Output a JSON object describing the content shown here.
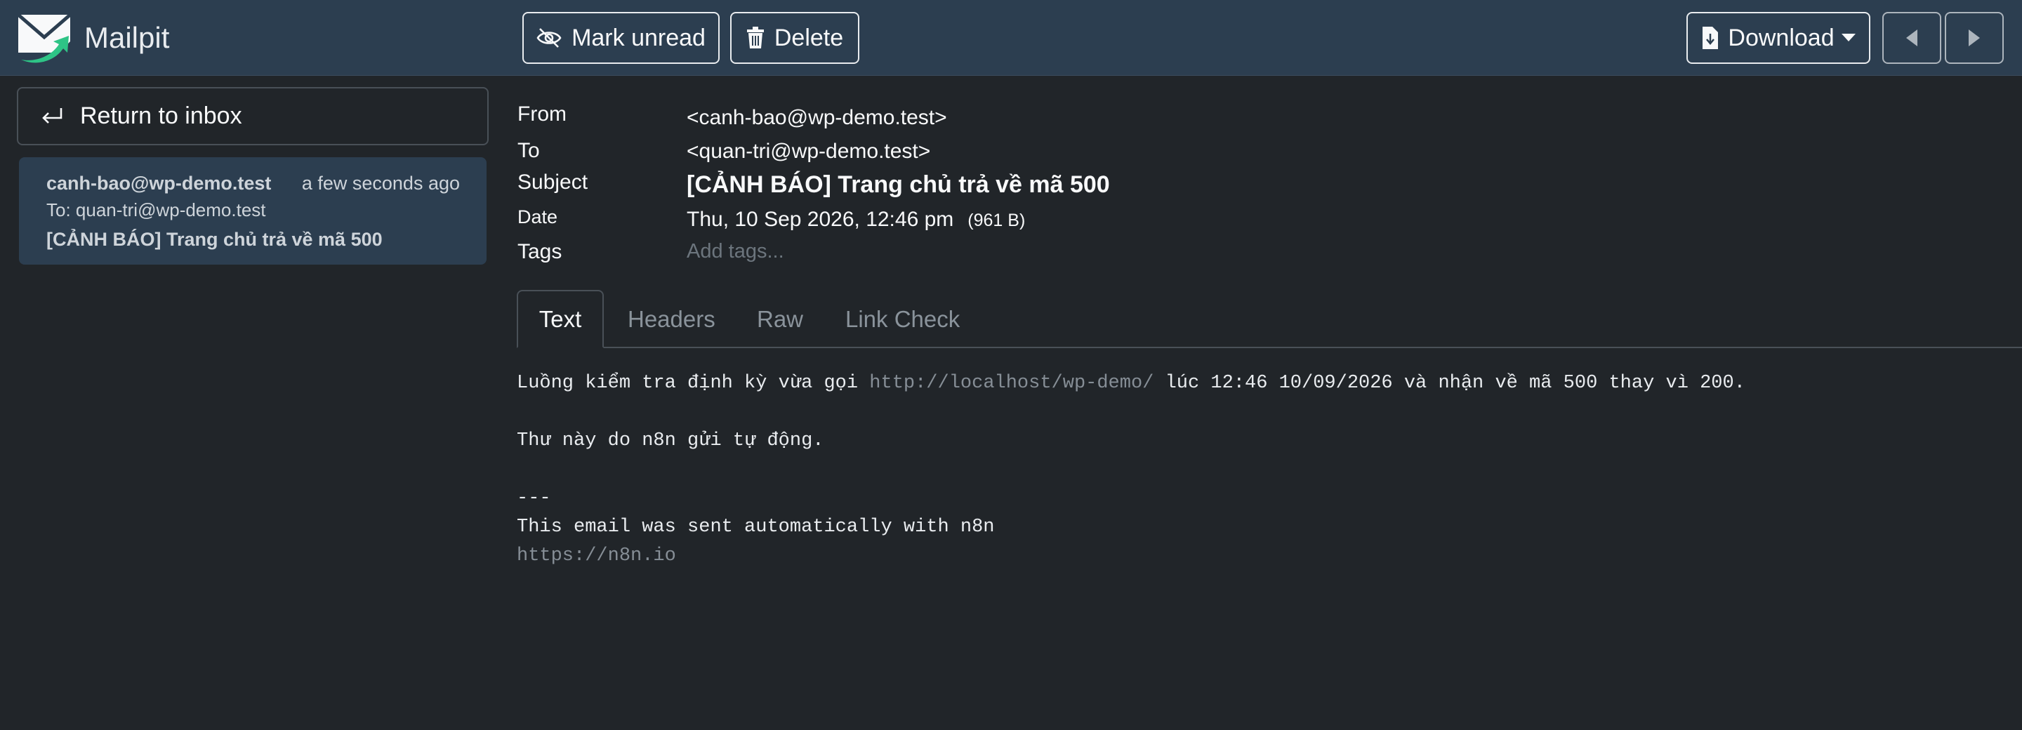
{
  "app": {
    "name": "Mailpit",
    "icon": "mailpit-logo-icon"
  },
  "toolbar": {
    "mark_unread_label": "Mark unread",
    "mark_unread_icon": "eye-slash-icon",
    "delete_label": "Delete",
    "delete_icon": "trash-icon",
    "download_label": "Download",
    "download_icon": "file-download-icon",
    "prev_icon": "caret-left-icon",
    "next_icon": "caret-right-icon"
  },
  "sidebar": {
    "return_label": "Return to inbox",
    "return_icon": "return-arrow-icon",
    "messages": [
      {
        "from": "canh-bao@wp-demo.test",
        "time": "a few seconds ago",
        "to": "To: quan-tri@wp-demo.test",
        "subject": "[CẢNH BÁO] Trang chủ trả về mã 500"
      }
    ]
  },
  "message": {
    "labels": {
      "from": "From",
      "to": "To",
      "subject": "Subject",
      "date": "Date",
      "tags": "Tags"
    },
    "from": "<canh-bao@wp-demo.test>",
    "to": "<quan-tri@wp-demo.test>",
    "subject": "[CẢNH BÁO] Trang chủ trả về mã 500",
    "date": "Thu, 10 Sep 2026, 12:46 pm",
    "size": "(961 B)",
    "tags_placeholder": "Add tags..."
  },
  "tabs": [
    {
      "label": "Text",
      "active": true
    },
    {
      "label": "Headers",
      "active": false
    },
    {
      "label": "Raw",
      "active": false
    },
    {
      "label": "Link Check",
      "active": false
    }
  ],
  "body": {
    "line1_before": "Luồng kiểm tra định kỳ vừa gọi ",
    "line1_link": "http://localhost/wp-demo/",
    "line1_after": " lúc 12:46 10/09/2026 và nhận về mã 500 thay vì 200.",
    "line2": "Thư này do n8n gửi tự động.",
    "separator": "---",
    "signature": "This email was sent automatically with n8n",
    "signature_link": "https://n8n.io"
  },
  "colors": {
    "navbar": "#2c3e50",
    "background": "#212529",
    "card": "#2c3e50",
    "logo_green": "#2ec486"
  }
}
